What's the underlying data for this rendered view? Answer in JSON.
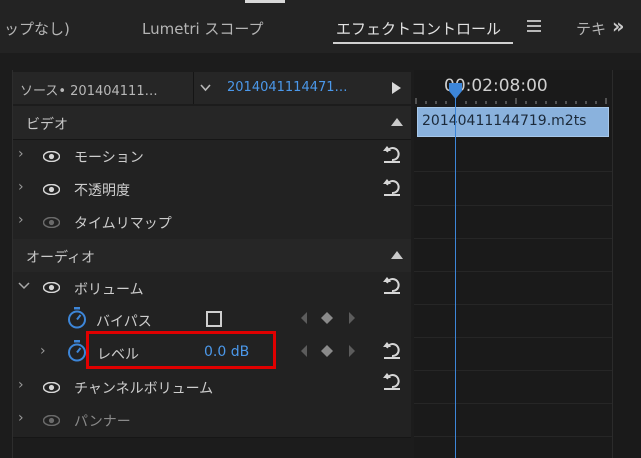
{
  "tabs": [
    {
      "label": "ップなし)"
    },
    {
      "label": "Lumetri スコープ"
    },
    {
      "label": "エフェクトコントロール"
    },
    {
      "label": "テキ"
    }
  ],
  "source": {
    "source_label": "ソース• 201404111…",
    "sequence_label": "2014041114471…"
  },
  "timeline": {
    "timecode": "00:02:08:00",
    "clip_name": "20140411144719.m2ts"
  },
  "sections": {
    "video": "ビデオ",
    "audio": "オーディオ"
  },
  "effects": {
    "motion": "モーション",
    "opacity": "不透明度",
    "time_remap": "タイムリマップ",
    "volume": "ボリューム",
    "bypass": "バイパス",
    "level": "レベル",
    "level_value": "0.0 dB",
    "channel_volume": "チャンネルボリューム",
    "panner": "パンナー"
  },
  "colors": {
    "accent_blue": "#3d86d8",
    "clip_blue": "#8ab2dd",
    "highlight_red": "#e00000"
  }
}
